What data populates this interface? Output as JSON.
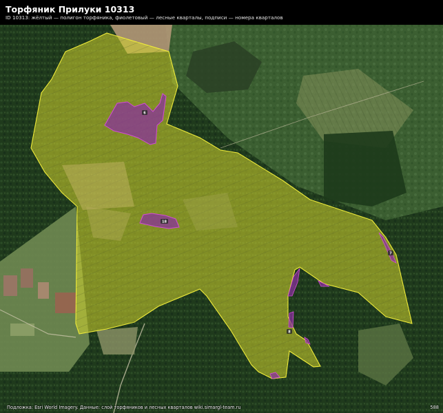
{
  "header": {
    "title": "Торфяник Прилуки 10313",
    "subtitle": "ID 10313: жёлтый — полигон торфяника, фиолетовый — лесные кварталы, подписи — номера кварталов"
  },
  "footer": {
    "attribution": "Подложка: Esri World Imagery. Данные: слой торфяников и лесных кварталов wiki.simargl-team.ru",
    "scale_note": "588"
  },
  "map": {
    "basemap": "satellite-imagery",
    "peat_color": "#d4d62e",
    "peat_outline": "#f0ec3a",
    "quarter_color": "#8a2fa0",
    "quarter_outline": "#d24bd6"
  },
  "quarter_labels": [
    "6",
    "18",
    "7",
    "8"
  ]
}
